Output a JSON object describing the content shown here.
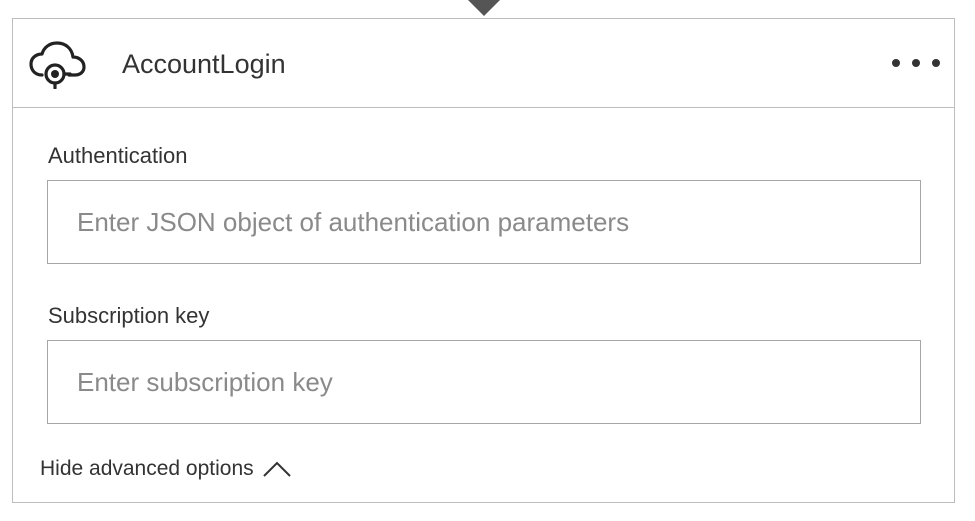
{
  "card": {
    "title": "AccountLogin",
    "icon": "cloud-connector-icon",
    "more_icon": "ellipsis-icon"
  },
  "fields": [
    {
      "label": "Authentication",
      "value": "",
      "placeholder": "Enter JSON object of authentication parameters"
    },
    {
      "label": "Subscription key",
      "value": "",
      "placeholder": "Enter subscription key"
    }
  ],
  "advanced": {
    "label": "Hide advanced options",
    "icon": "chevron-up-icon"
  },
  "colors": {
    "border": "#bdbdbd",
    "text": "#333333",
    "placeholder": "#8a8a8a",
    "connector": "#555555"
  }
}
